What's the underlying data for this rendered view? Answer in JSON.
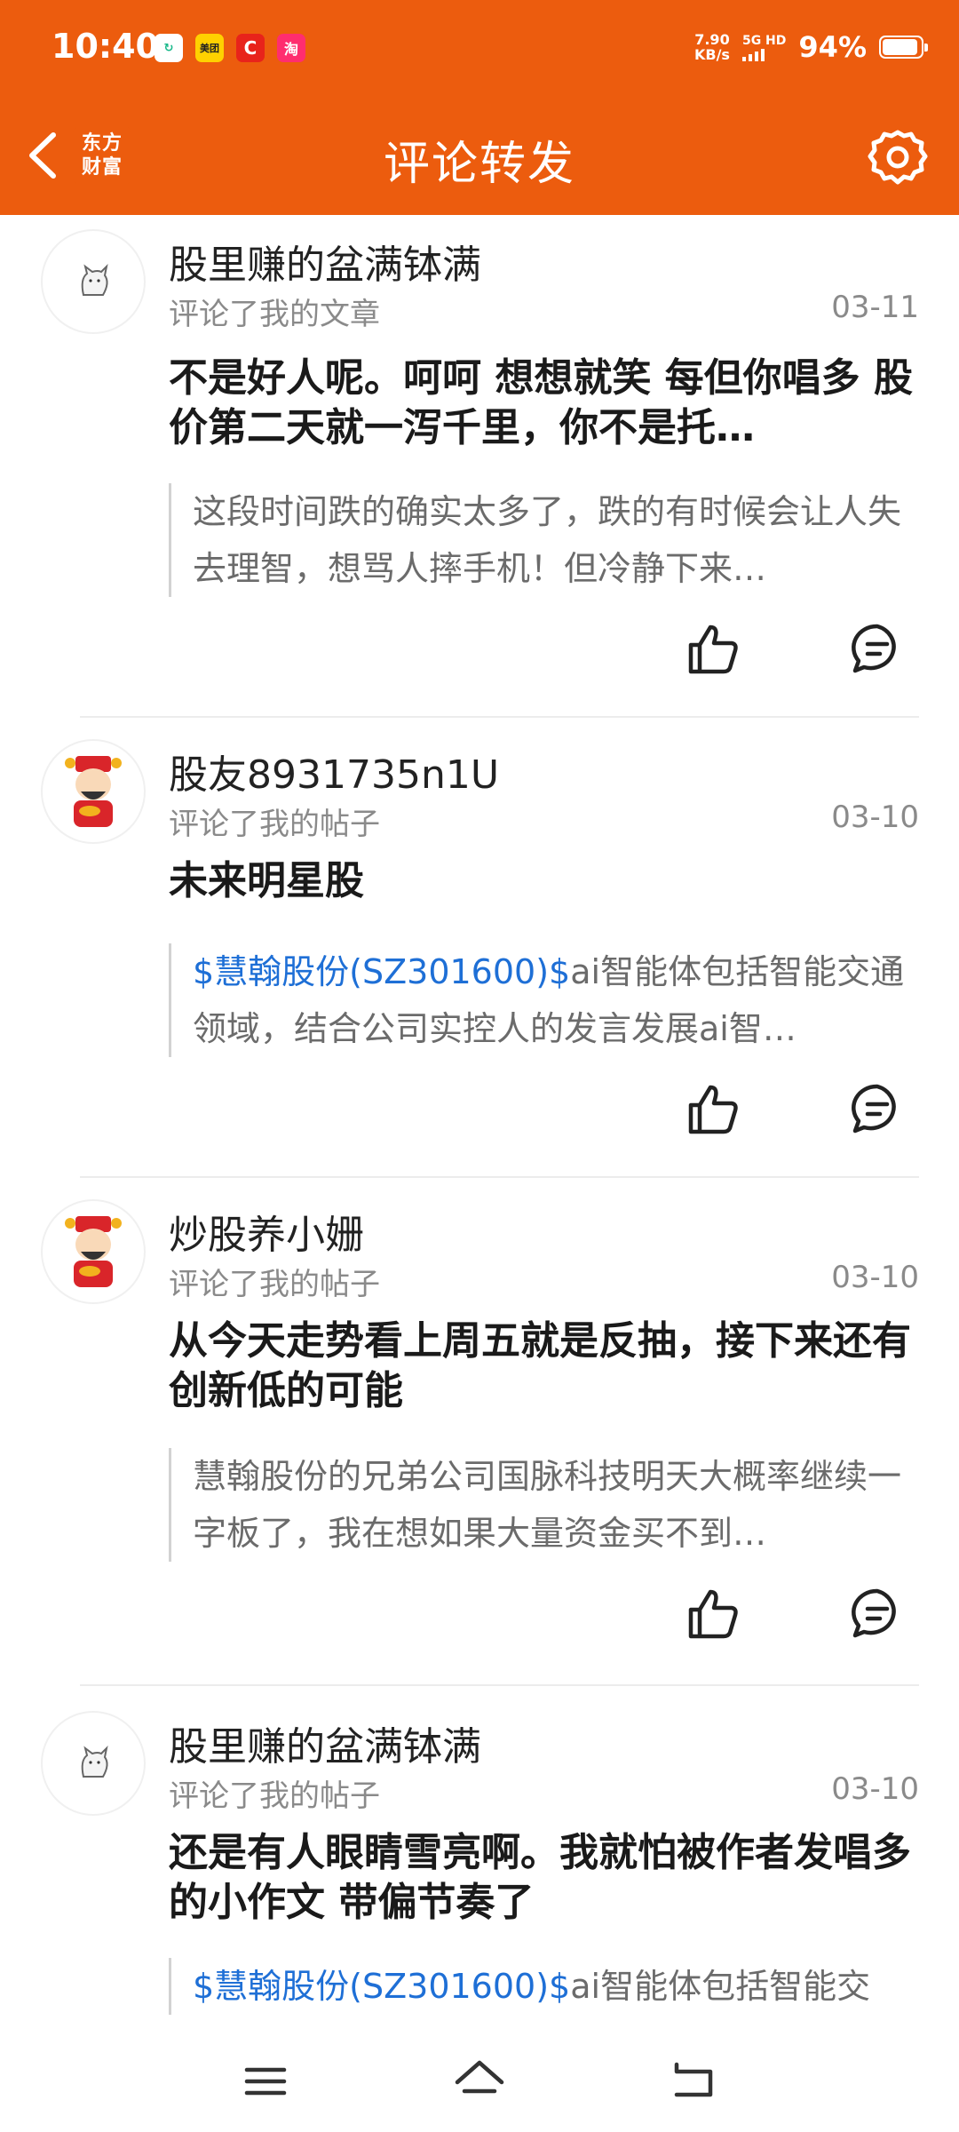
{
  "status_bar": {
    "time": "10:40",
    "apps": [
      {
        "name": "refresh-app-icon",
        "label": "C",
        "color": "#ffffff",
        "fg": "#19b88a"
      },
      {
        "name": "meituan-app-icon",
        "label": "美团",
        "color": "#FFD100",
        "fg": "#222222"
      },
      {
        "name": "c-app-icon",
        "label": "C",
        "color": "#E8231B",
        "fg": "#ffffff"
      },
      {
        "name": "taobao-app-icon",
        "label": "淘",
        "color": "#FF2D6F",
        "fg": "#ffffff"
      }
    ],
    "net_speed_value": "7.90",
    "net_speed_unit": "KB/s",
    "signal_label": "5G HD",
    "battery": "94%",
    "battery_level": 0.94
  },
  "nav": {
    "title": "评论转发",
    "logo_line1": "东方",
    "logo_line2": "财富"
  },
  "colors": {
    "brand": "#EC5C0E",
    "link": "#1E6FD6"
  },
  "items": [
    {
      "avatar": "cat-avatar",
      "username": "股里赚的盆满钵满",
      "action": "评论了我的文章",
      "date": "03-11",
      "comment": "不是好人呢。呵呵 想想就笑  每但你唱多 股价第二天就一泻千里，你不是托…",
      "quote_link": "",
      "quote": "这段时间跌的确实太多了，跌的有时候会让人失去理智，想骂人摔手机！但冷静下来…"
    },
    {
      "avatar": "caishen-avatar",
      "username": "股友8931735n1U",
      "action": "评论了我的帖子",
      "date": "03-10",
      "comment": "未来明星股",
      "quote_link": "$慧翰股份(SZ301600)$",
      "quote": "ai智能体包括智能交通领域，结合公司实控人的发言发展ai智…"
    },
    {
      "avatar": "caishen-avatar",
      "username": "炒股养小姗",
      "action": "评论了我的帖子",
      "date": "03-10",
      "comment": "从今天走势看上周五就是反抽，接下来还有创新低的可能",
      "quote_link": "",
      "quote": "慧翰股份的兄弟公司国脉科技明天大概率继续一字板了，我在想如果大量资金买不到…"
    },
    {
      "avatar": "cat-avatar",
      "username": "股里赚的盆满钵满",
      "action": "评论了我的帖子",
      "date": "03-10",
      "comment": "还是有人眼睛雪亮啊。我就怕被作者发唱多的小作文 带偏节奏了",
      "quote_link": "$慧翰股份(SZ301600)$",
      "quote": "ai智能体包括智能交"
    }
  ]
}
